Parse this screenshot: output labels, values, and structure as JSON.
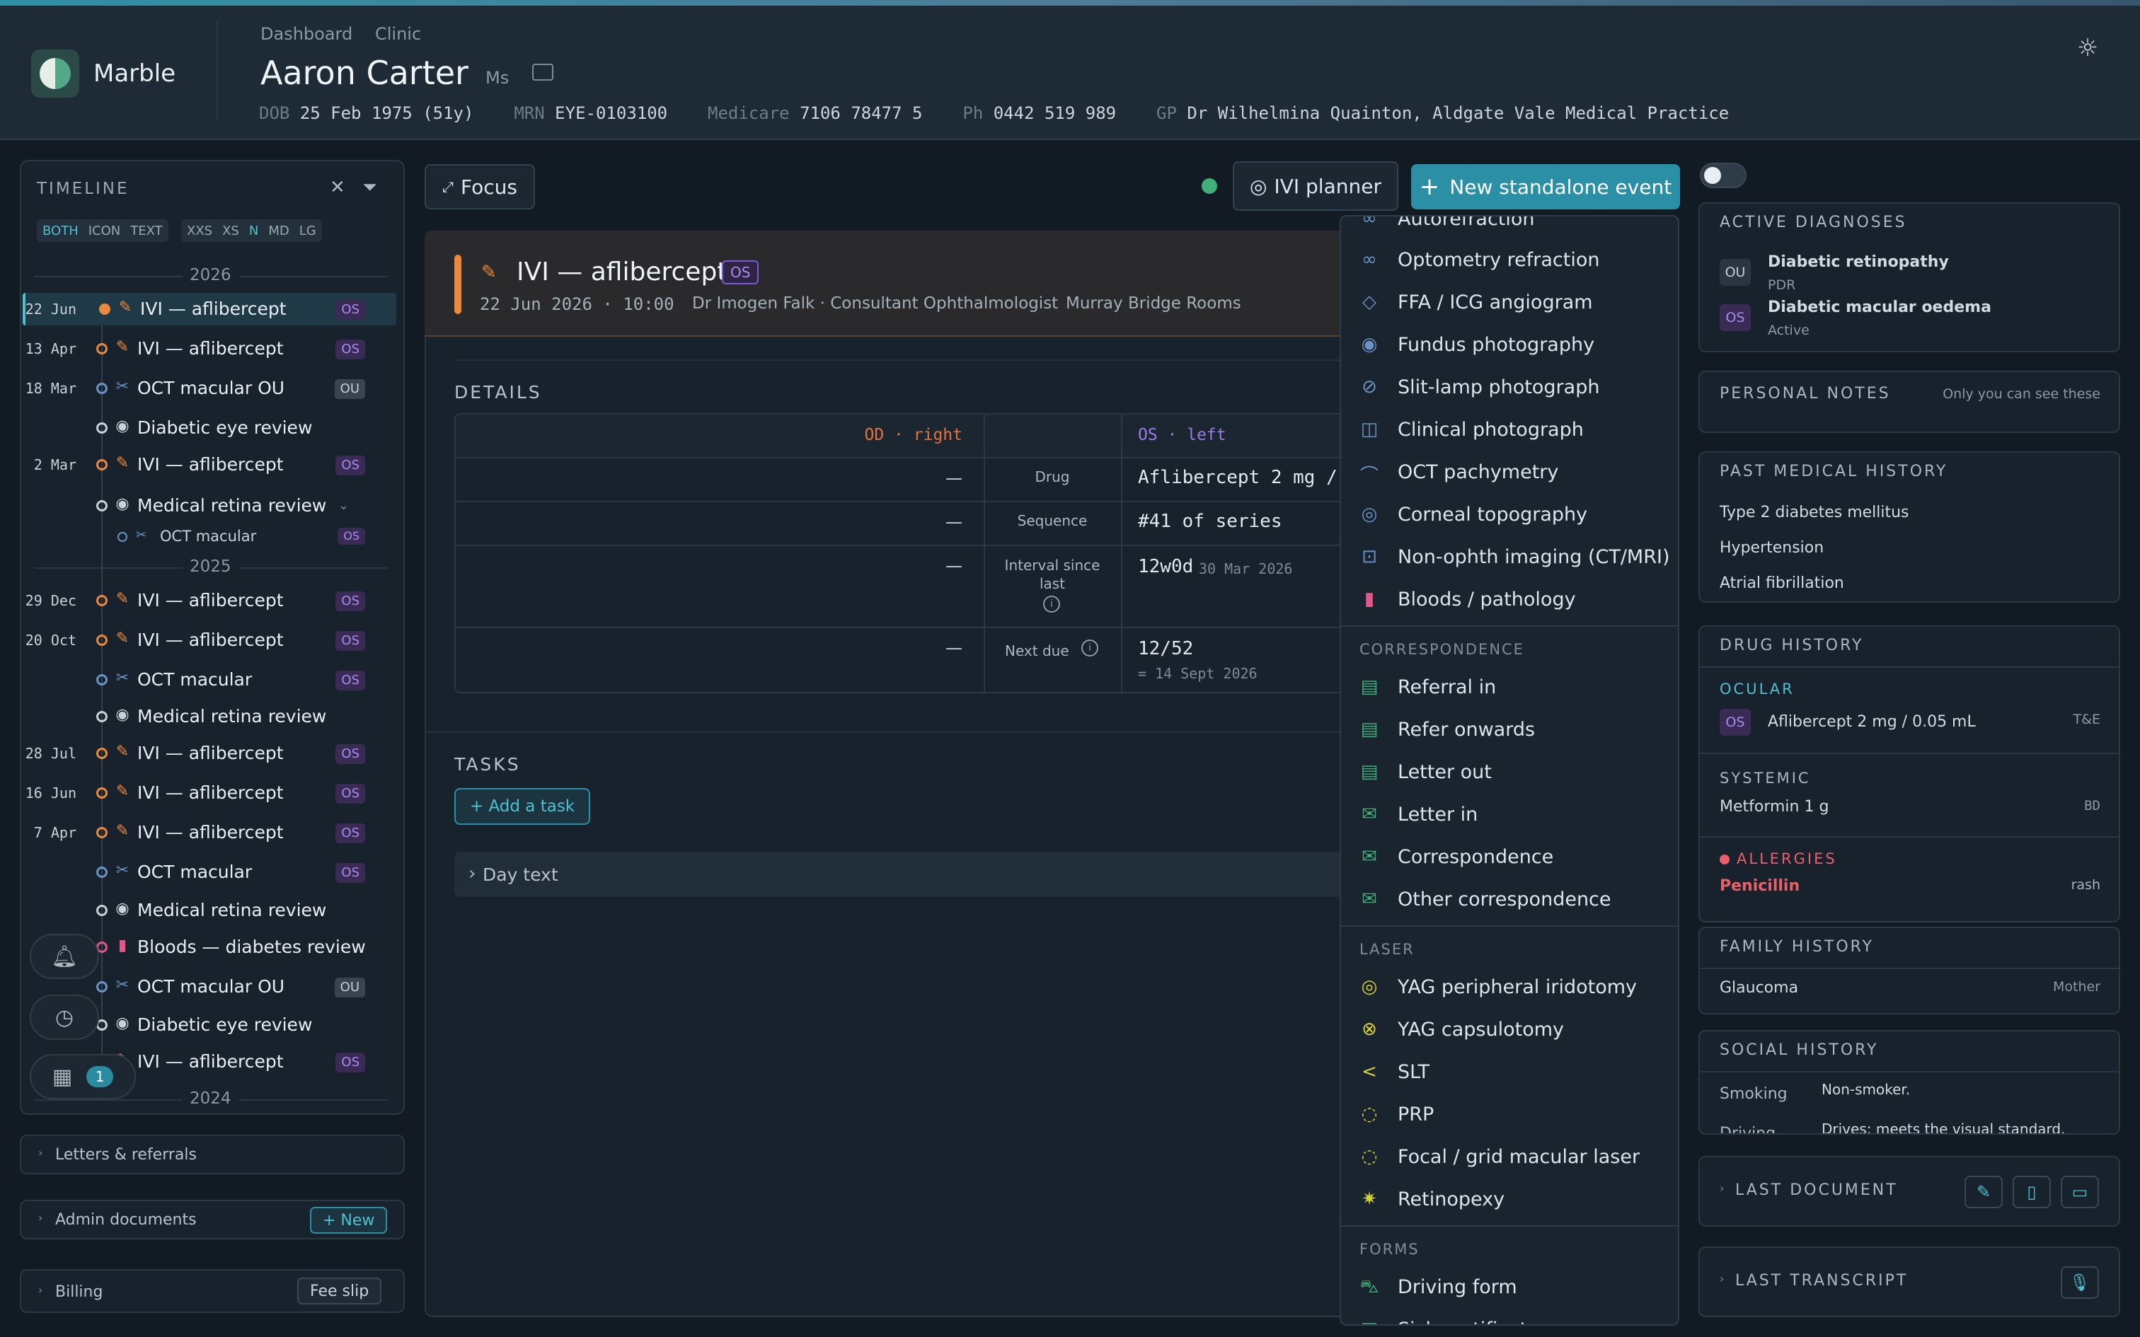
{
  "app": {
    "brand": "Marble"
  },
  "breadcrumb": [
    "Dashboard",
    "Clinic"
  ],
  "patient": {
    "name": "Aaron Carter",
    "title": "Ms",
    "dob_label": "DOB",
    "dob": "25 Feb 1975 (51y)",
    "mrn_label": "MRN",
    "mrn": "EYE-0103100",
    "medicare_label": "Medicare",
    "medicare": "7106 78477 5",
    "ph_label": "Ph",
    "ph": "0442 519 989",
    "gp_label": "GP",
    "gp": "Dr Wilhelmina Quainton, Aldgate Vale Medical Practice"
  },
  "timeline": {
    "title": "TIMELINE",
    "modes": [
      "BOTH",
      "ICON",
      "TEXT"
    ],
    "sizes": [
      "XXS",
      "XS",
      "N",
      "MD",
      "LG"
    ],
    "years": [
      "2026",
      "2025",
      "2024"
    ],
    "rows": [
      {
        "date": "22 Jun",
        "label": "IVI — aflibercept",
        "eye": "OS"
      },
      {
        "date": "13 Apr",
        "label": "IVI — aflibercept",
        "eye": "OS"
      },
      {
        "date": "18 Mar",
        "label": "OCT macular OU",
        "eye": "OU"
      },
      {
        "date": "",
        "label": "Diabetic eye review",
        "eye": ""
      },
      {
        "date": "2 Mar",
        "label": "IVI — aflibercept",
        "eye": "OS"
      },
      {
        "date": "",
        "label": "Medical retina review",
        "eye": ""
      },
      {
        "date": "",
        "label": "OCT macular",
        "eye": "OS"
      },
      {
        "date": "29 Dec",
        "label": "IVI — aflibercept",
        "eye": "OS"
      },
      {
        "date": "20 Oct",
        "label": "IVI — aflibercept",
        "eye": "OS"
      },
      {
        "date": "",
        "label": "OCT macular",
        "eye": "OS"
      },
      {
        "date": "",
        "label": "Medical retina review",
        "eye": ""
      },
      {
        "date": "28 Jul",
        "label": "IVI — aflibercept",
        "eye": "OS"
      },
      {
        "date": "16 Jun",
        "label": "IVI — aflibercept",
        "eye": "OS"
      },
      {
        "date": "7 Apr",
        "label": "IVI — aflibercept",
        "eye": "OS"
      },
      {
        "date": "",
        "label": "OCT macular",
        "eye": "OS"
      },
      {
        "date": "",
        "label": "Medical retina review",
        "eye": ""
      },
      {
        "date": "",
        "label": "Bloods — diabetes review",
        "eye": ""
      },
      {
        "date": "",
        "label": "OCT macular OU",
        "eye": "OU"
      },
      {
        "date": "",
        "label": "Diabetic eye review",
        "eye": ""
      },
      {
        "date": "",
        "label": "IVI — aflibercept",
        "eye": "OS"
      }
    ],
    "notification_count": "1"
  },
  "left_sections": {
    "letters": "Letters & referrals",
    "admin": "Admin documents",
    "admin_btn": "+ New",
    "billing": "Billing",
    "billing_btn": "Fee slip"
  },
  "toolbar": {
    "focus": "Focus",
    "ivi_planner": "IVI planner",
    "new_event": "New standalone event"
  },
  "event": {
    "title": "IVI — aflibercept",
    "eye": "OS",
    "date": "22 Jun 2026",
    "time": "10:00",
    "clinician": "Dr Imogen Falk · Consultant Ophthalmologist",
    "location": "Murray Bridge Rooms"
  },
  "details": {
    "heading": "DETAILS",
    "od_header": "OD · right",
    "os_header": "OS · left",
    "rows": [
      {
        "label": "Drug",
        "od": "—",
        "os": "Aflibercept 2 mg /",
        "os_sub": ""
      },
      {
        "label": "Sequence",
        "od": "—",
        "os": "#41 of series",
        "os_sub": ""
      },
      {
        "label": "Interval since last",
        "od": "—",
        "os": "12w0d",
        "os_sub": "30 Mar 2026"
      },
      {
        "label": "Next due",
        "od": "—",
        "os": "12/52",
        "os_sub": "= 14 Sept 2026"
      }
    ]
  },
  "tasks": {
    "heading": "TASKS",
    "add": "+ Add a task",
    "day_text": "Day text"
  },
  "dropdown": {
    "top_cut": "Autorefraction",
    "imaging": [
      "Optometry refraction",
      "FFA / ICG angiogram",
      "Fundus photography",
      "Slit-lamp photograph",
      "Clinical photograph",
      "OCT pachymetry",
      "Corneal topography",
      "Non-ophth imaging (CT/MRI)",
      "Bloods / pathology"
    ],
    "correspondence_header": "CORRESPONDENCE",
    "correspondence": [
      "Referral in",
      "Refer onwards",
      "Letter out",
      "Letter in",
      "Correspondence",
      "Other correspondence"
    ],
    "laser_header": "LASER",
    "laser": [
      "YAG peripheral iridotomy",
      "YAG capsulotomy",
      "SLT",
      "PRP",
      "Focal / grid macular laser",
      "Retinopexy"
    ],
    "forms_header": "FORMS",
    "forms": [
      "Driving form",
      "Sick certificate"
    ]
  },
  "right": {
    "diagnoses_h": "ACTIVE DIAGNOSES",
    "diagnoses": [
      {
        "eye": "OU",
        "name": "Diabetic retinopathy",
        "sub": "PDR"
      },
      {
        "eye": "OS",
        "name": "Diabetic macular oedema",
        "sub": "Active"
      }
    ],
    "notes_h": "PERSONAL NOTES",
    "notes_sub": "Only you can see these",
    "pmh_h": "PAST MEDICAL HISTORY",
    "pmh": [
      "Type 2 diabetes mellitus",
      "Hypertension",
      "Atrial fibrillation"
    ],
    "drug_h": "DRUG HISTORY",
    "ocular_h": "OCULAR",
    "ocular_eye": "OS",
    "ocular_drug": "Aflibercept 2 mg / 0.05 mL",
    "ocular_regimen": "T&E",
    "systemic_h": "SYSTEMIC",
    "systemic_drug": "Metformin 1 g",
    "systemic_freq": "BD",
    "allergies_h": "ALLERGIES",
    "allergy": "Penicillin",
    "allergy_reaction": "rash",
    "family_h": "FAMILY HISTORY",
    "family": "Glaucoma",
    "family_rel": "Mother",
    "social_h": "SOCIAL HISTORY",
    "smoking_k": "Smoking",
    "smoking_v": "Non-smoker.",
    "driving_k": "Driving",
    "driving_v": "Drives; meets the visual standard.",
    "last_doc_h": "LAST DOCUMENT",
    "last_transcript_h": "LAST TRANSCRIPT"
  }
}
